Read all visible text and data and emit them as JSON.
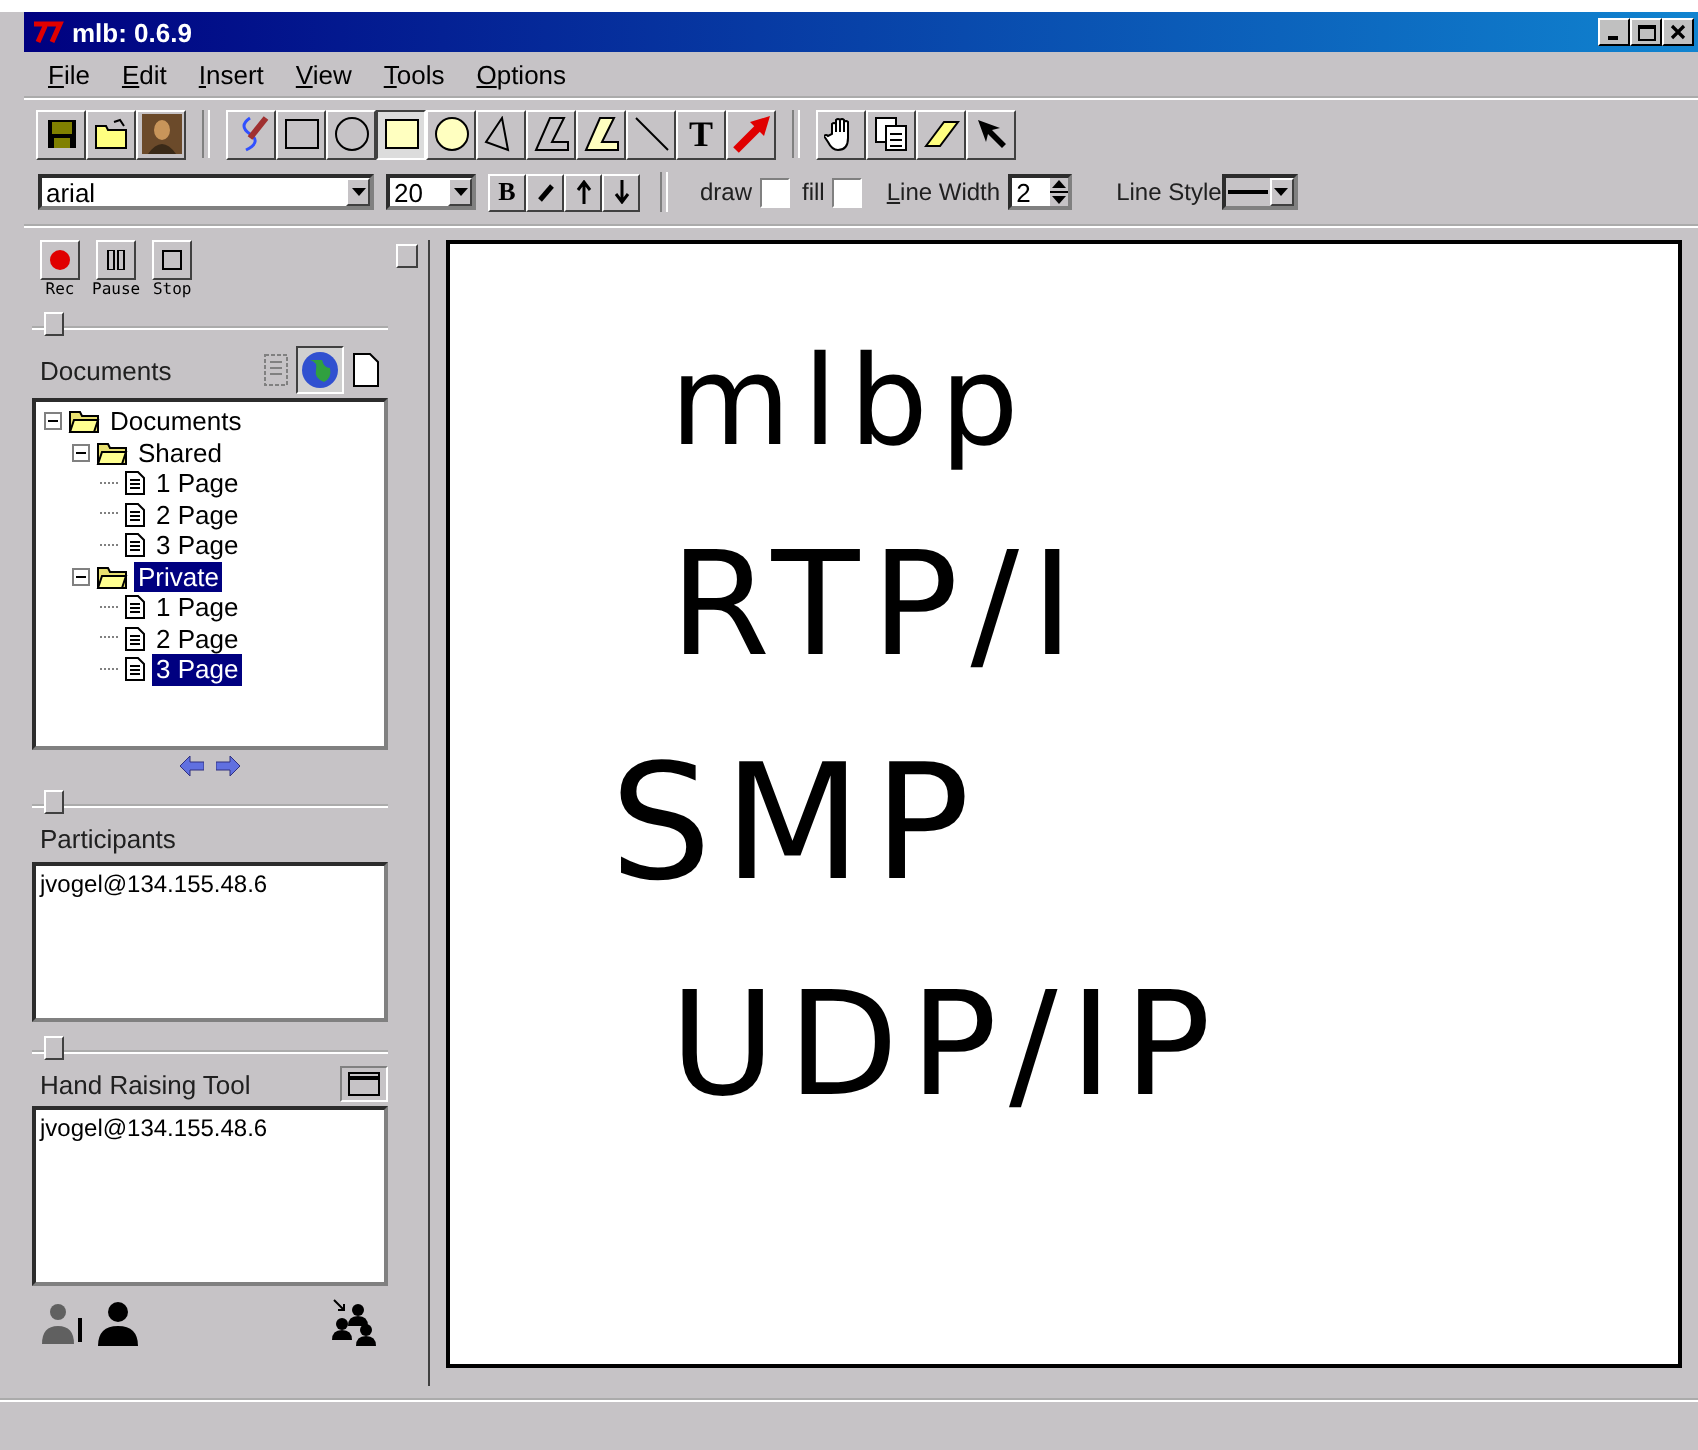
{
  "window": {
    "title": "mlb: 0.6.9"
  },
  "menu": [
    "File",
    "Edit",
    "Insert",
    "View",
    "Tools",
    "Options"
  ],
  "toolbar": {
    "file_tools": [
      {
        "kind": "save"
      },
      {
        "kind": "open"
      },
      {
        "kind": "image"
      }
    ],
    "draw_tools": [
      {
        "kind": "freehand",
        "selected": false
      },
      {
        "kind": "rect",
        "selected": false
      },
      {
        "kind": "circle",
        "selected": false
      },
      {
        "kind": "filled-rect",
        "selected": true
      },
      {
        "kind": "filled-circle",
        "selected": false
      },
      {
        "kind": "triangle",
        "selected": false
      },
      {
        "kind": "polygon",
        "selected": false
      },
      {
        "kind": "filled-polygon",
        "selected": false
      },
      {
        "kind": "line",
        "selected": false
      },
      {
        "kind": "text",
        "label": "T",
        "selected": false
      },
      {
        "kind": "arrow",
        "selected": false
      }
    ],
    "edit_tools": [
      {
        "kind": "hand",
        "selected": false
      },
      {
        "kind": "copy",
        "selected": false
      },
      {
        "kind": "eraser",
        "selected": false
      },
      {
        "kind": "pointer",
        "selected": false
      }
    ]
  },
  "format_bar": {
    "font": "arial",
    "size": "20",
    "style_buttons": [
      {
        "kind": "bold",
        "label": "B"
      },
      {
        "kind": "italic"
      },
      {
        "kind": "up"
      },
      {
        "kind": "down"
      }
    ],
    "draw": {
      "label": "draw",
      "checked": false
    },
    "fill": {
      "label": "fill",
      "checked": false
    },
    "line_width": {
      "label": "Line Width",
      "value": "2"
    },
    "line_style": {
      "label": "Line Style"
    }
  },
  "recorder": [
    {
      "kind": "rec",
      "label": "Rec"
    },
    {
      "kind": "pause",
      "label": "Pause"
    },
    {
      "kind": "stop",
      "label": "Stop"
    }
  ],
  "documents": {
    "title": "Documents",
    "views": [
      {
        "kind": "list",
        "selected": false
      },
      {
        "kind": "globe",
        "selected": true
      },
      {
        "kind": "page",
        "selected": false
      }
    ],
    "tree": [
      {
        "label": "Documents",
        "kind": "folder",
        "expanded": true,
        "selected": false,
        "children": [
          {
            "label": "Shared",
            "kind": "folder",
            "expanded": true,
            "selected": false,
            "children": [
              {
                "label": "1 Page",
                "kind": "page",
                "selected": false
              },
              {
                "label": "2 Page",
                "kind": "page",
                "selected": false
              },
              {
                "label": "3 Page",
                "kind": "page",
                "selected": false
              }
            ]
          },
          {
            "label": "Private",
            "kind": "folder",
            "expanded": true,
            "selected": true,
            "children": [
              {
                "label": "1 Page",
                "kind": "page",
                "selected": false
              },
              {
                "label": "2 Page",
                "kind": "page",
                "selected": false
              },
              {
                "label": "3 Page",
                "kind": "page",
                "selected": true
              }
            ]
          }
        ]
      }
    ]
  },
  "participants": {
    "title": "Participants",
    "items": [
      "jvogel@134.155.48.6"
    ]
  },
  "hand_raising": {
    "title": "Hand Raising Tool",
    "items": [
      "jvogel@134.155.48.6"
    ]
  },
  "whiteboard": {
    "strokes": [
      "mlbp",
      "RTP/I",
      "SMP",
      "UDP/IP"
    ]
  }
}
